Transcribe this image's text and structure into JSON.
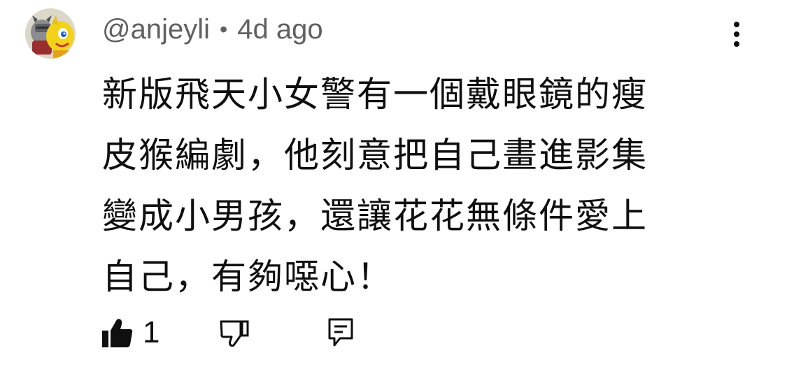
{
  "comment": {
    "author": "@anjeyli",
    "separator": "•",
    "timestamp": "4d ago",
    "text_lines": [
      "新版飛天小女警有一個戴眼鏡的瘦",
      "皮猴編劇，他刻意把自己畫進影集",
      "變成小男孩，還讓花花無條件愛上",
      "自己，有夠噁心！"
    ],
    "like_count": "1"
  },
  "icons": {
    "more": "more-vertical-icon",
    "like": "thumbs-up-filled-icon",
    "dislike": "thumbs-down-outline-icon",
    "reply": "reply-comment-icon"
  },
  "colors": {
    "text_primary": "#0f0f0f",
    "text_secondary": "#606060",
    "background": "#ffffff",
    "avatar_yellow": "#f3d21b"
  }
}
